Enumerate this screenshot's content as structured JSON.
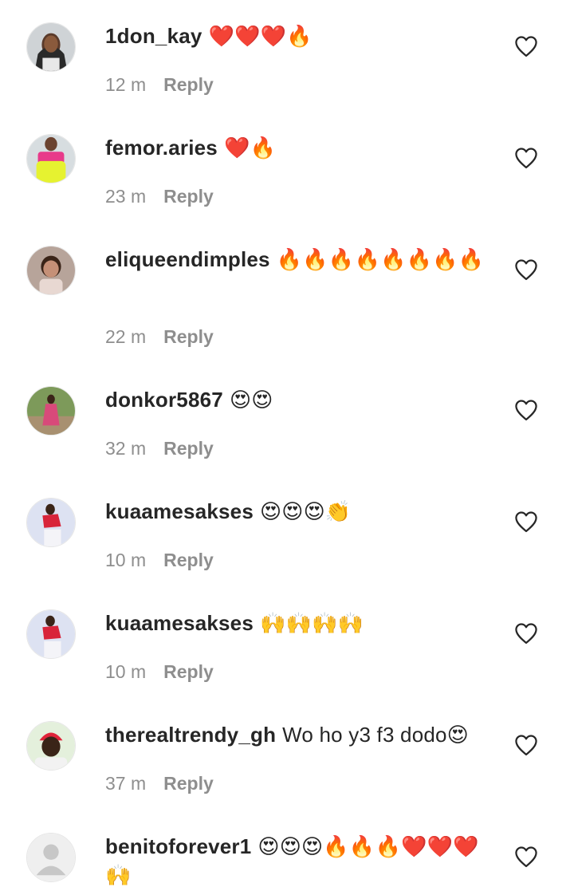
{
  "comments": [
    {
      "username": "1don_kay",
      "text": "❤️❤️❤️🔥",
      "time": "12 m",
      "reply": "Reply",
      "avatar": "avatar-woman-braids"
    },
    {
      "username": "femor.aries",
      "text": "❤️🔥",
      "time": "23 m",
      "reply": "Reply",
      "avatar": "avatar-yellow-outfit"
    },
    {
      "username": "eliqueendimples",
      "text": "🔥🔥🔥🔥🔥🔥🔥🔥",
      "time": "22 m",
      "reply": "Reply",
      "avatar": "avatar-child"
    },
    {
      "username": "donkor5867",
      "text": "😍😍",
      "time": "32 m",
      "reply": "Reply",
      "avatar": "avatar-outdoor-person"
    },
    {
      "username": "kuaamesakses",
      "text": "😍😍😍👏",
      "time": "10 m",
      "reply": "Reply",
      "avatar": "avatar-red-top"
    },
    {
      "username": "kuaamesakses",
      "text": "🙌🙌🙌🙌",
      "time": "10 m",
      "reply": "Reply",
      "avatar": "avatar-red-top"
    },
    {
      "username": "therealtrendy_gh",
      "text": "Wo ho y3 f3 dodo😍",
      "time": "37 m",
      "reply": "Reply",
      "avatar": "avatar-red-cap"
    },
    {
      "username": "benitoforever1",
      "text": "😍😍😍🔥🔥🔥❤️❤️❤️🙌",
      "time": "",
      "reply": "",
      "avatar": "avatar-default"
    }
  ],
  "colors": {
    "text": "#262626",
    "muted": "#8e8e8e",
    "background": "#ffffff"
  },
  "icons": {
    "like": "heart-outline-icon"
  }
}
